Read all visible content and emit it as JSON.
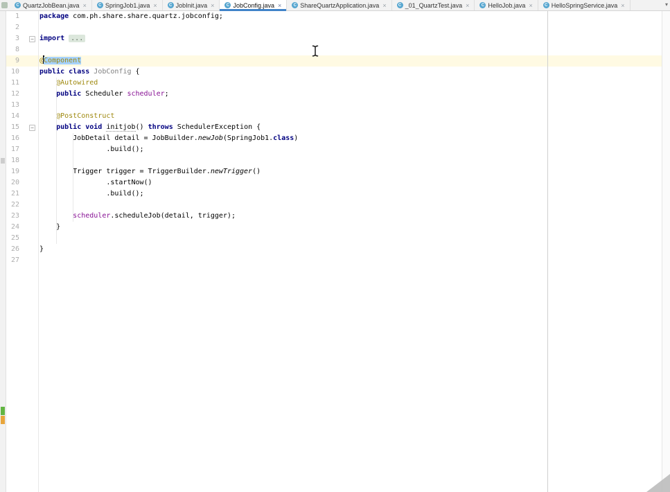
{
  "colors": {
    "keyword": "#000080",
    "annotation": "#9E880D",
    "field": "#871094",
    "unused": "#808080",
    "selection": "#A6D2FF",
    "caret_row": "#FFFAE3",
    "fold_bg": "#DCE7DC",
    "fold_fg": "#556355",
    "line_num": "#ADADAD",
    "tab_underline": "#4083C9"
  },
  "tab_bar": {
    "icon_letter": "C",
    "close_glyph": "×",
    "overflow_glyph": "▾",
    "tabs": [
      {
        "label": "QuartzJobBean.java",
        "active": false
      },
      {
        "label": "SpringJob1.java",
        "active": false
      },
      {
        "label": "JobInit.java",
        "active": false
      },
      {
        "label": "JobConfig.java",
        "active": true
      },
      {
        "label": "ShareQuartzApplication.java",
        "active": false
      },
      {
        "label": "_01_QuartzTest.java",
        "active": false
      },
      {
        "label": "HelloJob.java",
        "active": false
      },
      {
        "label": "HelloSpringService.java",
        "active": false
      }
    ]
  },
  "editor": {
    "fold_glyph": "−",
    "lines": [
      {
        "num": "1",
        "tokens": [
          [
            "kw",
            "package"
          ],
          [
            "pl",
            " com.ph.share.share.quartz.jobconfig;"
          ]
        ]
      },
      {
        "num": "2",
        "tokens": []
      },
      {
        "num": "3",
        "fold": true,
        "tokens": [
          [
            "kw",
            "import"
          ],
          [
            "pl",
            " "
          ],
          [
            "fold",
            "..."
          ]
        ]
      },
      {
        "num": "8",
        "tokens": []
      },
      {
        "num": "9",
        "current": true,
        "tokens": [
          [
            "ann",
            "@"
          ],
          [
            "caret",
            ""
          ],
          [
            "ann sel",
            "Component"
          ]
        ]
      },
      {
        "num": "10",
        "tokens": [
          [
            "kw",
            "public"
          ],
          [
            "pl",
            " "
          ],
          [
            "kw",
            "class"
          ],
          [
            "pl",
            " "
          ],
          [
            "gray",
            "JobConfig"
          ],
          [
            "pl",
            " {"
          ]
        ]
      },
      {
        "num": "11",
        "tokens": [
          [
            "pl",
            "    "
          ],
          [
            "ann",
            "@Autowired"
          ]
        ]
      },
      {
        "num": "12",
        "tokens": [
          [
            "pl",
            "    "
          ],
          [
            "kw",
            "public"
          ],
          [
            "pl",
            " Scheduler "
          ],
          [
            "fld",
            "scheduler"
          ],
          [
            "pl",
            ";"
          ]
        ]
      },
      {
        "num": "13",
        "tokens": []
      },
      {
        "num": "14",
        "tokens": [
          [
            "pl",
            "    "
          ],
          [
            "ann",
            "@PostConstruct"
          ]
        ]
      },
      {
        "num": "15",
        "fold": true,
        "tokens": [
          [
            "pl",
            "    "
          ],
          [
            "kw",
            "public"
          ],
          [
            "pl",
            " "
          ],
          [
            "kw",
            "void"
          ],
          [
            "pl",
            " "
          ],
          [
            "fn",
            "initjob"
          ],
          [
            "pl",
            "() "
          ],
          [
            "kw",
            "throws"
          ],
          [
            "pl",
            " SchedulerException {"
          ]
        ]
      },
      {
        "num": "16",
        "tokens": [
          [
            "pl",
            "        JobDetail detail = JobBuilder."
          ],
          [
            "it",
            "newJob"
          ],
          [
            "pl",
            "(SpringJob1."
          ],
          [
            "kw",
            "class"
          ],
          [
            "pl",
            ")"
          ]
        ]
      },
      {
        "num": "17",
        "tokens": [
          [
            "pl",
            "                .build();"
          ]
        ]
      },
      {
        "num": "18",
        "tokens": []
      },
      {
        "num": "19",
        "tokens": [
          [
            "pl",
            "        Trigger trigger = TriggerBuilder."
          ],
          [
            "it",
            "newTrigger"
          ],
          [
            "pl",
            "()"
          ]
        ]
      },
      {
        "num": "20",
        "tokens": [
          [
            "pl",
            "                .startNow()"
          ]
        ]
      },
      {
        "num": "21",
        "tokens": [
          [
            "pl",
            "                .build();"
          ]
        ]
      },
      {
        "num": "22",
        "tokens": []
      },
      {
        "num": "23",
        "tokens": [
          [
            "pl",
            "        "
          ],
          [
            "fld",
            "scheduler"
          ],
          [
            "pl",
            ".scheduleJob(detail, trigger);"
          ]
        ]
      },
      {
        "num": "24",
        "tokens": [
          [
            "pl",
            "    }"
          ]
        ]
      },
      {
        "num": "25",
        "tokens": []
      },
      {
        "num": "26",
        "tokens": [
          [
            "pl",
            "}"
          ]
        ]
      },
      {
        "num": "27",
        "tokens": []
      }
    ]
  }
}
